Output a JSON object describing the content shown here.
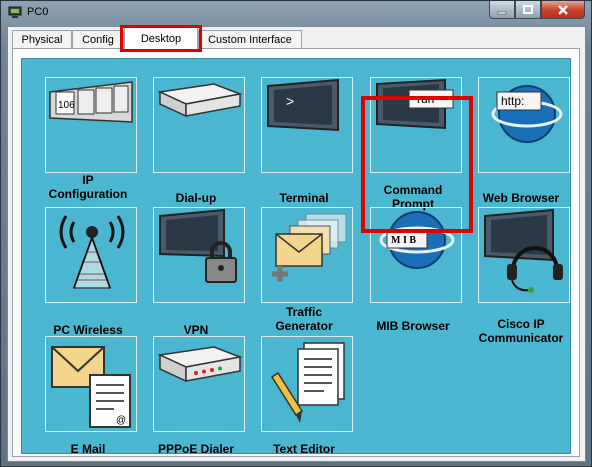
{
  "window": {
    "title": "PC0"
  },
  "tabs": [
    {
      "label": "Physical"
    },
    {
      "label": "Config"
    },
    {
      "label": "Desktop"
    },
    {
      "label": "Custom Interface"
    }
  ],
  "active_tab": "Desktop",
  "apps": [
    {
      "label": "IP\nConfiguration",
      "icon": "ip-configuration-icon",
      "screen_text": "106"
    },
    {
      "label": "Dial-up",
      "icon": "dialup-modem-icon"
    },
    {
      "label": "Terminal",
      "icon": "terminal-icon",
      "screen_text": ">"
    },
    {
      "label": "Command\nPrompt",
      "icon": "command-prompt-icon",
      "screen_text": "run"
    },
    {
      "label": "Web Browser",
      "icon": "web-browser-icon",
      "screen_text": "http:"
    },
    {
      "label": "PC Wireless",
      "icon": "wireless-antenna-icon"
    },
    {
      "label": "VPN",
      "icon": "vpn-lock-icon"
    },
    {
      "label": "Traffic\nGenerator",
      "icon": "traffic-generator-icon"
    },
    {
      "label": "MIB Browser",
      "icon": "mib-browser-icon",
      "screen_text": "M I B"
    },
    {
      "label": "Cisco IP\nCommunicator",
      "icon": "ip-communicator-headset-icon"
    },
    {
      "label": "E Mail",
      "icon": "email-icon"
    },
    {
      "label": "PPPoE Dialer",
      "icon": "pppoe-dialer-icon"
    },
    {
      "label": "Text Editor",
      "icon": "text-editor-icon"
    }
  ],
  "colors": {
    "desktop_background": "#4ab6d0",
    "highlight_outline": "#e00000"
  }
}
